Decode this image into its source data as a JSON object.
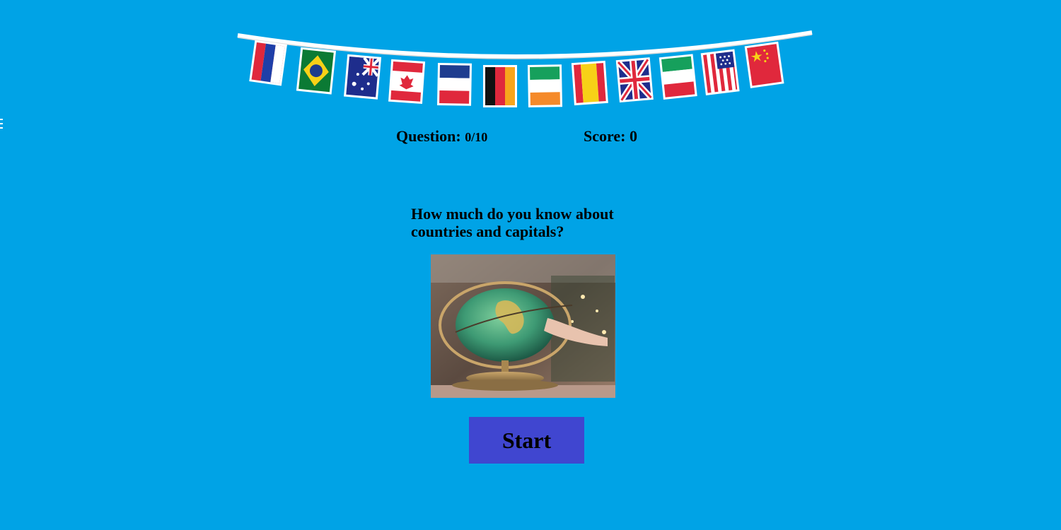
{
  "banner": {
    "flags": [
      {
        "icon": "russia-flag-icon"
      },
      {
        "icon": "brazil-flag-icon"
      },
      {
        "icon": "australia-flag-icon"
      },
      {
        "icon": "canada-flag-icon"
      },
      {
        "icon": "france-flag-icon"
      },
      {
        "icon": "germany-flag-icon"
      },
      {
        "icon": "ireland-flag-icon"
      },
      {
        "icon": "spain-flag-icon"
      },
      {
        "icon": "uk-flag-icon"
      },
      {
        "icon": "italy-flag-icon"
      },
      {
        "icon": "usa-flag-icon"
      },
      {
        "icon": "china-flag-icon"
      }
    ]
  },
  "status": {
    "question_label": "Question:",
    "question_value": "0/10",
    "score_label": "Score:",
    "score_value": "0"
  },
  "intro": {
    "heading": "How much do you know about countries and capitals?"
  },
  "image": {
    "icon": "globe-image"
  },
  "start_button": {
    "label": "Start"
  },
  "colors": {
    "background": "#00a3e6",
    "button": "#4046d0",
    "text": "#000000"
  }
}
